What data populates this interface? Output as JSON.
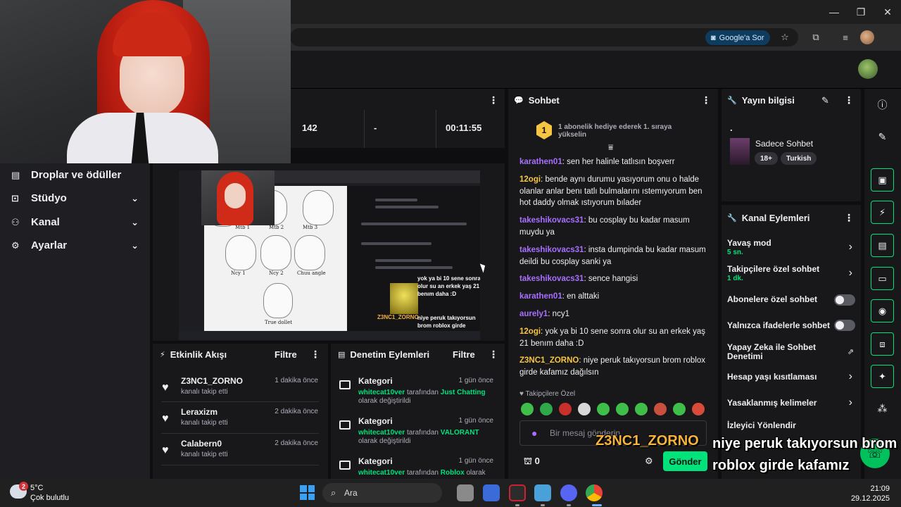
{
  "browser": {
    "google_button": "Google'a Sor",
    "window_controls": [
      "—",
      "❐",
      "✕"
    ]
  },
  "sidebar": {
    "items": [
      {
        "label": "Droplar ve ödüller",
        "icon": "gift-icon",
        "chevron": false
      },
      {
        "label": "Stüdyo",
        "icon": "studio-icon",
        "chevron": true
      },
      {
        "label": "Kanal",
        "icon": "people-icon",
        "chevron": true
      },
      {
        "label": "Ayarlar",
        "icon": "gear-icon",
        "chevron": true
      }
    ]
  },
  "stats": {
    "values": [
      "142",
      "-",
      "00:11:55"
    ]
  },
  "activity": {
    "title": "Etkinlik Akışı",
    "filter": "Filtre",
    "items": [
      {
        "name": "Z3NC1_ZORNO",
        "desc": "kanalı takip etti",
        "time": "1 dakika önce"
      },
      {
        "name": "Leraxizm",
        "desc": "kanalı takip etti",
        "time": "2 dakika önce"
      },
      {
        "name": "Calabern0",
        "desc": "kanalı takip etti",
        "time": "2 dakika önce"
      }
    ]
  },
  "moderation": {
    "title": "Denetim Eylemleri",
    "filter": "Filtre",
    "items": [
      {
        "title": "Kategori",
        "time": "1 gün önce",
        "user": "whitecat10ver",
        "mid": "tarafından",
        "value": "Just Chatting",
        "tail": "olarak değiştirildi"
      },
      {
        "title": "Kategori",
        "time": "1 gün önce",
        "user": "whitecat10ver",
        "mid": "tarafından",
        "value": "VALORANT",
        "tail": "olarak değiştirildi"
      },
      {
        "title": "Kategori",
        "time": "1 gün önce",
        "user": "whitecat10ver",
        "mid": "tarafından",
        "value": "Roblox",
        "tail": "olarak"
      }
    ]
  },
  "chat": {
    "title": "Sohbet",
    "hype_badge": "1",
    "hype_text": "1 abonelik hediye ederek 1. sıraya yükselin",
    "messages": [
      {
        "user": "karathen01",
        "text": "sen her halinle tatlısın boşverr",
        "cls": "u1"
      },
      {
        "user": "12ogi",
        "text": "bende aynı durumu yasıyorum onu o halde olanlar anlar benı tatlı bulmalarını ıstemıyorum ben hot daddy olmak ıstıyorum bılader",
        "cls": "u2"
      },
      {
        "user": "takeshikovacs31",
        "text": "bu cosplay bu kadar masum muydu ya",
        "cls": "u3"
      },
      {
        "user": "takeshikovacs31",
        "text": "insta dumpinda bu kadar masum deildi bu cosplay sanki ya",
        "cls": "u3"
      },
      {
        "user": "takeshikovacs31",
        "text": "sence hangisi",
        "cls": "u3"
      },
      {
        "user": "karathen01",
        "text": "en alttaki",
        "cls": "u1"
      },
      {
        "user": "aurely1",
        "text": "ncy1",
        "cls": "u1"
      },
      {
        "user": "12ogi",
        "text": "yok ya bi 10 sene sonra olur su an erkek yaş 21 benım daha :D",
        "cls": "u2"
      },
      {
        "user": "Z3NC1_ZORNO",
        "text": "niye peruk takıyorsun brom roblox girde kafamız dağılsın",
        "cls": "u2"
      }
    ],
    "followers_only": "Takipçilere Özel",
    "input_placeholder": "Bir mesaj gönderin",
    "points": "0",
    "send": "Gönder"
  },
  "stream_info": {
    "title": "Yayın bilgisi",
    "stream_title": ".",
    "category": "Sadece Sohbet",
    "tags": [
      "18+",
      "Turkish"
    ]
  },
  "channel_actions": {
    "title": "Kanal Eylemleri",
    "items": [
      {
        "label": "Yavaş mod",
        "sub": "5 sn.",
        "ctrl": "chevron"
      },
      {
        "label": "Takipçilere özel sohbet",
        "sub": "1 dk.",
        "ctrl": "chevron"
      },
      {
        "label": "Abonelere özel sohbet",
        "sub": "",
        "ctrl": "toggle"
      },
      {
        "label": "Yalnızca ifadelerle sohbet",
        "sub": "",
        "ctrl": "toggle"
      },
      {
        "label": "Yapay Zeka ile Sohbet Denetimi",
        "sub": "",
        "ctrl": "external"
      },
      {
        "label": "Hesap yaşı kısıtlaması",
        "sub": "",
        "ctrl": "chevron"
      },
      {
        "label": "Yasaklanmış kelimeler",
        "sub": "",
        "ctrl": "chevron"
      },
      {
        "label": "İzleyici Yönlendir",
        "sub": "",
        "ctrl": "none"
      }
    ]
  },
  "overlay": {
    "name": "Z3NC1_ZORNO",
    "message": "niye peruk takıyorsun brom roblox girde kafamız dağılsın"
  },
  "preview_overlay": {
    "text": "yok ya bi 10 sene sonra olur su an erkek yaş 21 benım daha :D",
    "name": "Z3NC1_ZORNO",
    "msg": "niye peruk takıyorsun brom roblox girde kafamız dağılsın"
  },
  "sketch_labels": [
    "Mtb 1",
    "Mtb 2",
    "Mtb 3",
    "Ncy 1",
    "Ncy 2",
    "Chuu angle",
    "True dollet"
  ],
  "taskbar": {
    "weather_temp": "5°C",
    "weather_desc": "Çok bulutlu",
    "weather_badge": "2",
    "search_label": "Ara",
    "time": "21:09",
    "date": "29.12.2025"
  }
}
